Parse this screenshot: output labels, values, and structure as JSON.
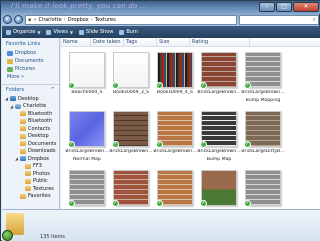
{
  "overlay_text": "I'll make it look pretty, you can do ...",
  "window_controls": {
    "minimize": "–",
    "maximize": "□",
    "close": "✕"
  },
  "address": {
    "crumbs": [
      "Charlotte",
      "Dropbox",
      "Textures"
    ]
  },
  "toolbar": {
    "items": [
      {
        "label": "Organize",
        "has_arrow": true
      },
      {
        "label": "Views",
        "has_arrow": true
      },
      {
        "label": "Slide Show",
        "has_arrow": false
      },
      {
        "label": "Burn",
        "has_arrow": false
      }
    ]
  },
  "favorites": {
    "heading": "Favorite Links",
    "items": [
      "Dropbox",
      "Documents",
      "Pictures"
    ],
    "more": "More »"
  },
  "folders": {
    "heading": "Folders",
    "items": [
      {
        "label": "Desktop",
        "level": 0,
        "kind": "desk",
        "expanded": true
      },
      {
        "label": "Charlotte",
        "level": 1,
        "kind": "user",
        "expanded": true
      },
      {
        "label": "Bluetooth",
        "level": 2,
        "kind": "folder"
      },
      {
        "label": "Bluetooth",
        "level": 2,
        "kind": "folder"
      },
      {
        "label": "Contacts",
        "level": 2,
        "kind": "folder"
      },
      {
        "label": "Desktop",
        "level": 2,
        "kind": "folder"
      },
      {
        "label": "Documents",
        "level": 2,
        "kind": "folder"
      },
      {
        "label": "Downloads",
        "level": 2,
        "kind": "folder"
      },
      {
        "label": "Dropbox",
        "level": 2,
        "kind": "box",
        "expanded": true
      },
      {
        "label": "FF3",
        "level": 3,
        "kind": "folder"
      },
      {
        "label": "Photos",
        "level": 3,
        "kind": "folder"
      },
      {
        "label": "Public",
        "level": 3,
        "kind": "folder"
      },
      {
        "label": "Textures",
        "level": 3,
        "kind": "folder"
      },
      {
        "label": "Favorites",
        "level": 2,
        "kind": "folder"
      }
    ]
  },
  "columns": [
    "Name",
    "Date taken",
    "Tags",
    "Size",
    "Rating"
  ],
  "files": [
    {
      "name": "Beach0004_S",
      "name2": "",
      "pattern": "blank"
    },
    {
      "name": "Books0009_3_S",
      "name2": "",
      "pattern": "blank"
    },
    {
      "name": "Books0009_4_S",
      "name2": "",
      "pattern": "books"
    },
    {
      "name": "BrickLargeBrown...",
      "name2": "",
      "pattern": "brick_red"
    },
    {
      "name": "BrickLargeBrown...",
      "name2": "Bump Mapping",
      "pattern": "brick_grey"
    },
    {
      "name": "BrickLargeBrown...",
      "name2": "Normal Map",
      "pattern": "normal"
    },
    {
      "name": "BrickLargeBrown...",
      "name2": "",
      "pattern": "brick_dark"
    },
    {
      "name": "BrickLargeBrown...",
      "name2": "",
      "pattern": "brick_orange"
    },
    {
      "name": "BrickLargeBrown...",
      "name2": "Bump Map",
      "pattern": "brick_bw"
    },
    {
      "name": "BrickLargeDirtyB...",
      "name2": "",
      "pattern": "brick_dirty"
    },
    {
      "name": "",
      "name2": "",
      "pattern": "brick_grey"
    },
    {
      "name": "",
      "name2": "",
      "pattern": "brick_red2"
    },
    {
      "name": "",
      "name2": "",
      "pattern": "brick_orange"
    },
    {
      "name": "",
      "name2": "",
      "pattern": "brick_grass"
    },
    {
      "name": "",
      "name2": "",
      "pattern": "brick_grey"
    }
  ],
  "status": {
    "count_text": "135 items"
  }
}
